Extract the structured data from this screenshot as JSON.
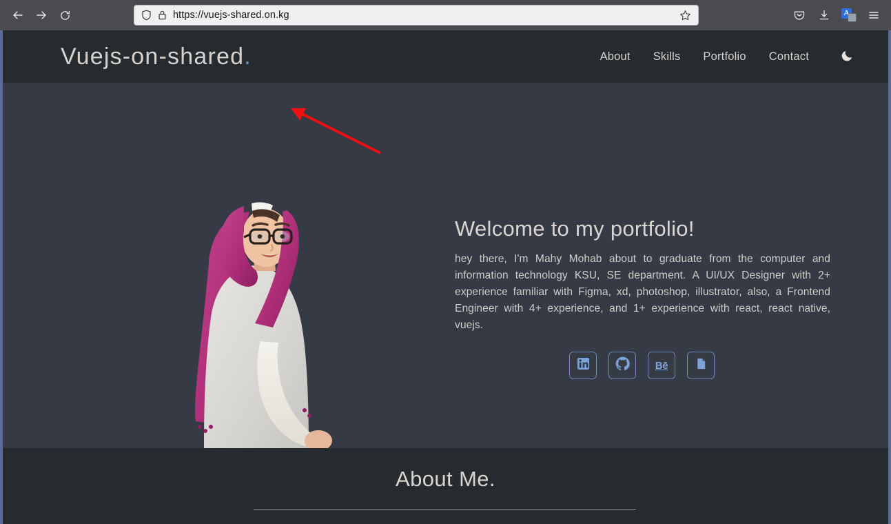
{
  "browser": {
    "back_icon": "back-arrow-icon",
    "forward_icon": "forward-arrow-icon",
    "reload_icon": "reload-icon",
    "shield_icon": "shield-icon",
    "lock_icon": "padlock-icon",
    "bookmark_icon": "star-outline-icon",
    "pocket_icon": "pocket-icon",
    "downloads_icon": "download-icon",
    "translate_icon": "translate-icon",
    "translate_letter": "A",
    "menu_icon": "hamburger-menu-icon",
    "url": "https://vuejs-shared.on.kg"
  },
  "site": {
    "logo_text": "Vuejs-on-shared",
    "logo_dot": ".",
    "nav": [
      {
        "label": "About"
      },
      {
        "label": "Skills"
      },
      {
        "label": "Portfolio"
      },
      {
        "label": "Contact"
      }
    ],
    "theme_toggle_icon": "moon-icon"
  },
  "hero": {
    "title": "Welcome to my portfolio!",
    "description": "hey there, I'm Mahy Mohab about to graduate from the computer and information technology KSU, SE department. A UI/UX Designer with 2+ experience familiar with Figma, xd, photoshop, illustrator, also, a Frontend Engineer with 4+ experience, and 1+ experience with react, react native, vuejs.",
    "photo_alt": "portrait-photo",
    "socials": [
      {
        "name": "linkedin",
        "icon": "linkedin-icon",
        "label": "in"
      },
      {
        "name": "github",
        "icon": "github-icon",
        "label": ""
      },
      {
        "name": "behance",
        "icon": "behance-icon",
        "label": "Bē"
      },
      {
        "name": "resume",
        "icon": "document-icon",
        "label": ""
      }
    ]
  },
  "about": {
    "title": "About Me."
  },
  "annotation": {
    "arrow_color": "#ee1111",
    "arrow_name": "red-pointer-arrow"
  },
  "colors": {
    "chrome_bg": "#4a4a4f",
    "header_bg": "#262b2f",
    "hero_bg": "#353a45",
    "accent_blue": "#6e8fc9",
    "social_blue": "#7ba3d9",
    "edge_stripe": "#5b6a9b",
    "text_primary": "#d9d6d2"
  }
}
